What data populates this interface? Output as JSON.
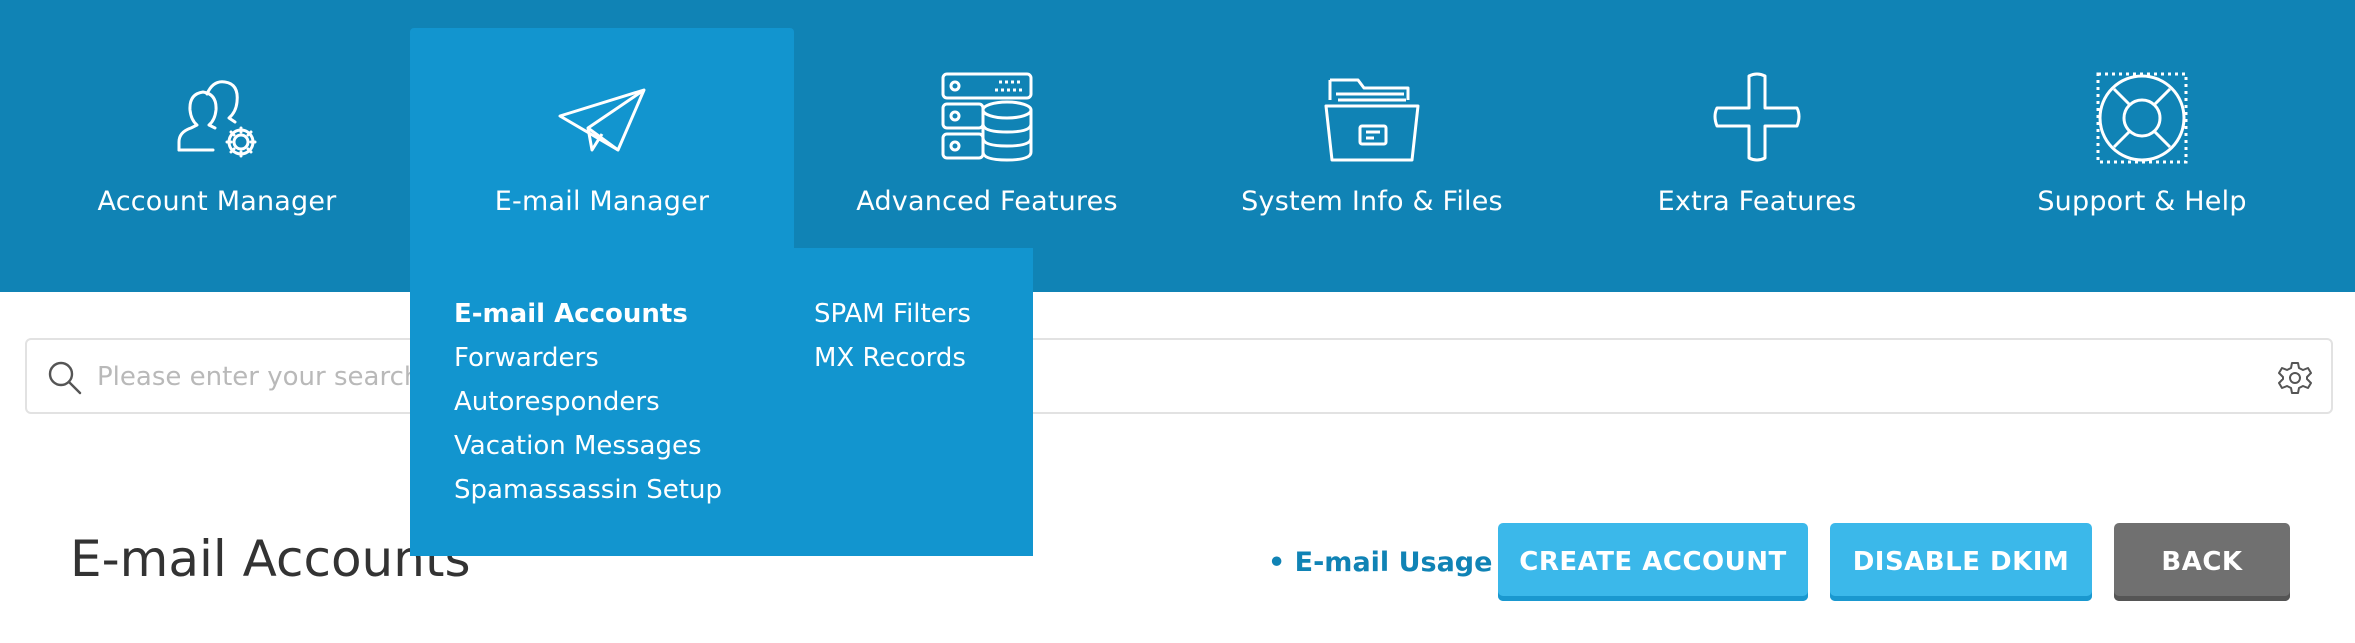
{
  "nav": {
    "items": [
      {
        "label": "Account Manager",
        "icon": "users-gear-icon"
      },
      {
        "label": "E-mail Manager",
        "icon": "paper-plane-icon",
        "active": true
      },
      {
        "label": "Advanced Features",
        "icon": "server-database-icon"
      },
      {
        "label": "System Info & Files",
        "icon": "file-folder-icon"
      },
      {
        "label": "Extra Features",
        "icon": "plus-icon"
      },
      {
        "label": "Support & Help",
        "icon": "lifebuoy-icon"
      }
    ]
  },
  "dropdown": {
    "col1": [
      "E-mail Accounts",
      "Forwarders",
      "Autoresponders",
      "Vacation Messages",
      "Spamassassin Setup"
    ],
    "col2": [
      "SPAM Filters",
      "MX Records"
    ]
  },
  "search": {
    "placeholder": "Please enter your search criteria",
    "value": ""
  },
  "page": {
    "title": "E-mail Accounts",
    "usage_link": "• E-mail Usage",
    "buttons": {
      "create": "CREATE ACCOUNT",
      "dkim": "DISABLE DKIM",
      "back": "BACK"
    }
  },
  "colors": {
    "nav_bg": "#1083b5",
    "nav_active": "#1295cf",
    "primary_button": "#3bb8ea",
    "back_button": "#707070"
  }
}
